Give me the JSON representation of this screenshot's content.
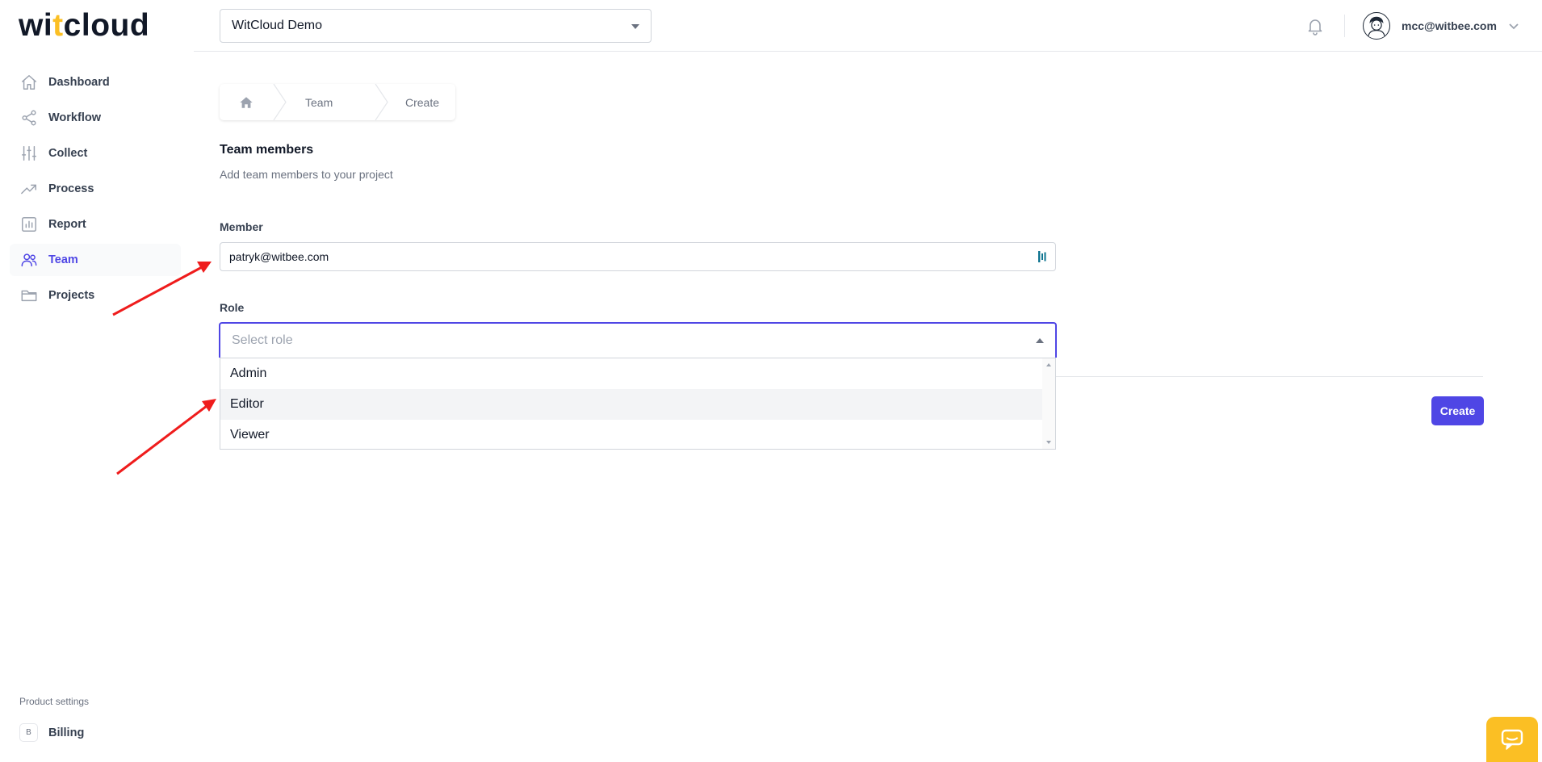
{
  "brand": {
    "logo_text_a": "wi",
    "logo_text_dot": "t",
    "logo_text_b": "cloud",
    "accent_color": "#4f46e5",
    "brand_yellow": "#fbbf24"
  },
  "sidebar": {
    "items": [
      {
        "label": "Dashboard",
        "icon": "home-icon"
      },
      {
        "label": "Workflow",
        "icon": "share-icon"
      },
      {
        "label": "Collect",
        "icon": "sliders-icon"
      },
      {
        "label": "Process",
        "icon": "trending-up-icon"
      },
      {
        "label": "Report",
        "icon": "chart-icon"
      },
      {
        "label": "Team",
        "icon": "users-icon",
        "active": true
      },
      {
        "label": "Projects",
        "icon": "folder-icon"
      }
    ],
    "settings_heading": "Product settings",
    "billing": {
      "badge": "B",
      "label": "Billing"
    }
  },
  "topbar": {
    "project": "WitCloud Demo",
    "user_email": "mcc@witbee.com"
  },
  "breadcrumb": {
    "team": "Team",
    "create": "Create"
  },
  "form": {
    "title": "Team members",
    "subtitle": "Add team members to your project",
    "member_label": "Member",
    "member_value": "patryk@witbee.com",
    "role_label": "Role",
    "role_placeholder": "Select role",
    "role_options": [
      "Admin",
      "Editor",
      "Viewer"
    ],
    "hovered_option": "Editor",
    "submit_label": "Create"
  }
}
